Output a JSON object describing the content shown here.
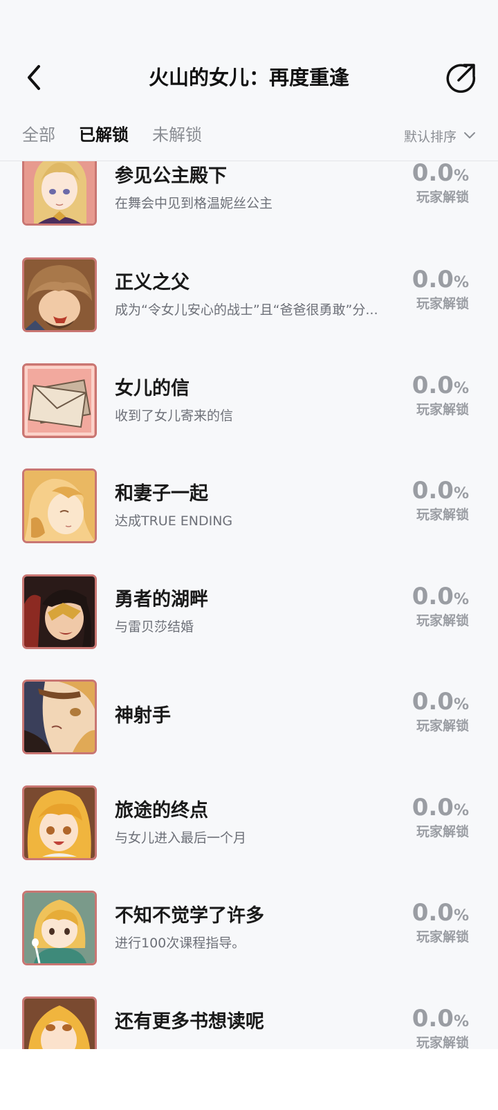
{
  "header": {
    "title": "火山的女儿：再度重逢",
    "back_icon": "chevron-left-icon",
    "share_icon": "share-arrow-icon"
  },
  "tabs": [
    {
      "label": "全部",
      "active": false
    },
    {
      "label": "已解锁",
      "active": true
    },
    {
      "label": "未解锁",
      "active": false
    }
  ],
  "sort": {
    "label": "默认排序",
    "icon": "chevron-down-icon"
  },
  "achievements": [
    {
      "name": "参见公主殿下",
      "desc": "在舞会中见到格温妮丝公主",
      "percent": "0.0",
      "unit": "%",
      "label": "玩家解锁",
      "image": "blonde-princess"
    },
    {
      "name": "正义之父",
      "desc": "成为“令女儿安心的战士”且“爸爸很勇敢”分...",
      "percent": "0.0",
      "unit": "%",
      "label": "玩家解锁",
      "image": "father"
    },
    {
      "name": "女儿的信",
      "desc": "收到了女儿寄来的信",
      "percent": "0.0",
      "unit": "%",
      "label": "玩家解锁",
      "image": "letter"
    },
    {
      "name": "和妻子一起",
      "desc": "达成TRUE ENDING",
      "percent": "0.0",
      "unit": "%",
      "label": "玩家解锁",
      "image": "wife"
    },
    {
      "name": "勇者的湖畔",
      "desc": "与雷贝莎结婚",
      "percent": "0.0",
      "unit": "%",
      "label": "玩家解锁",
      "image": "masked-hero"
    },
    {
      "name": "神射手",
      "desc": "",
      "percent": "0.0",
      "unit": "%",
      "label": "玩家解锁",
      "image": "marksman"
    },
    {
      "name": "旅途的终点",
      "desc": "与女儿进入最后一个月",
      "percent": "0.0",
      "unit": "%",
      "label": "玩家解锁",
      "image": "daughter-smile"
    },
    {
      "name": "不知不觉学了许多",
      "desc": "进行100次课程指导。",
      "percent": "0.0",
      "unit": "%",
      "label": "玩家解锁",
      "image": "daughter-study"
    },
    {
      "name": "还有更多书想读呢",
      "desc": "",
      "percent": "0.0",
      "unit": "%",
      "label": "玩家解锁",
      "image": "daughter-books"
    }
  ]
}
